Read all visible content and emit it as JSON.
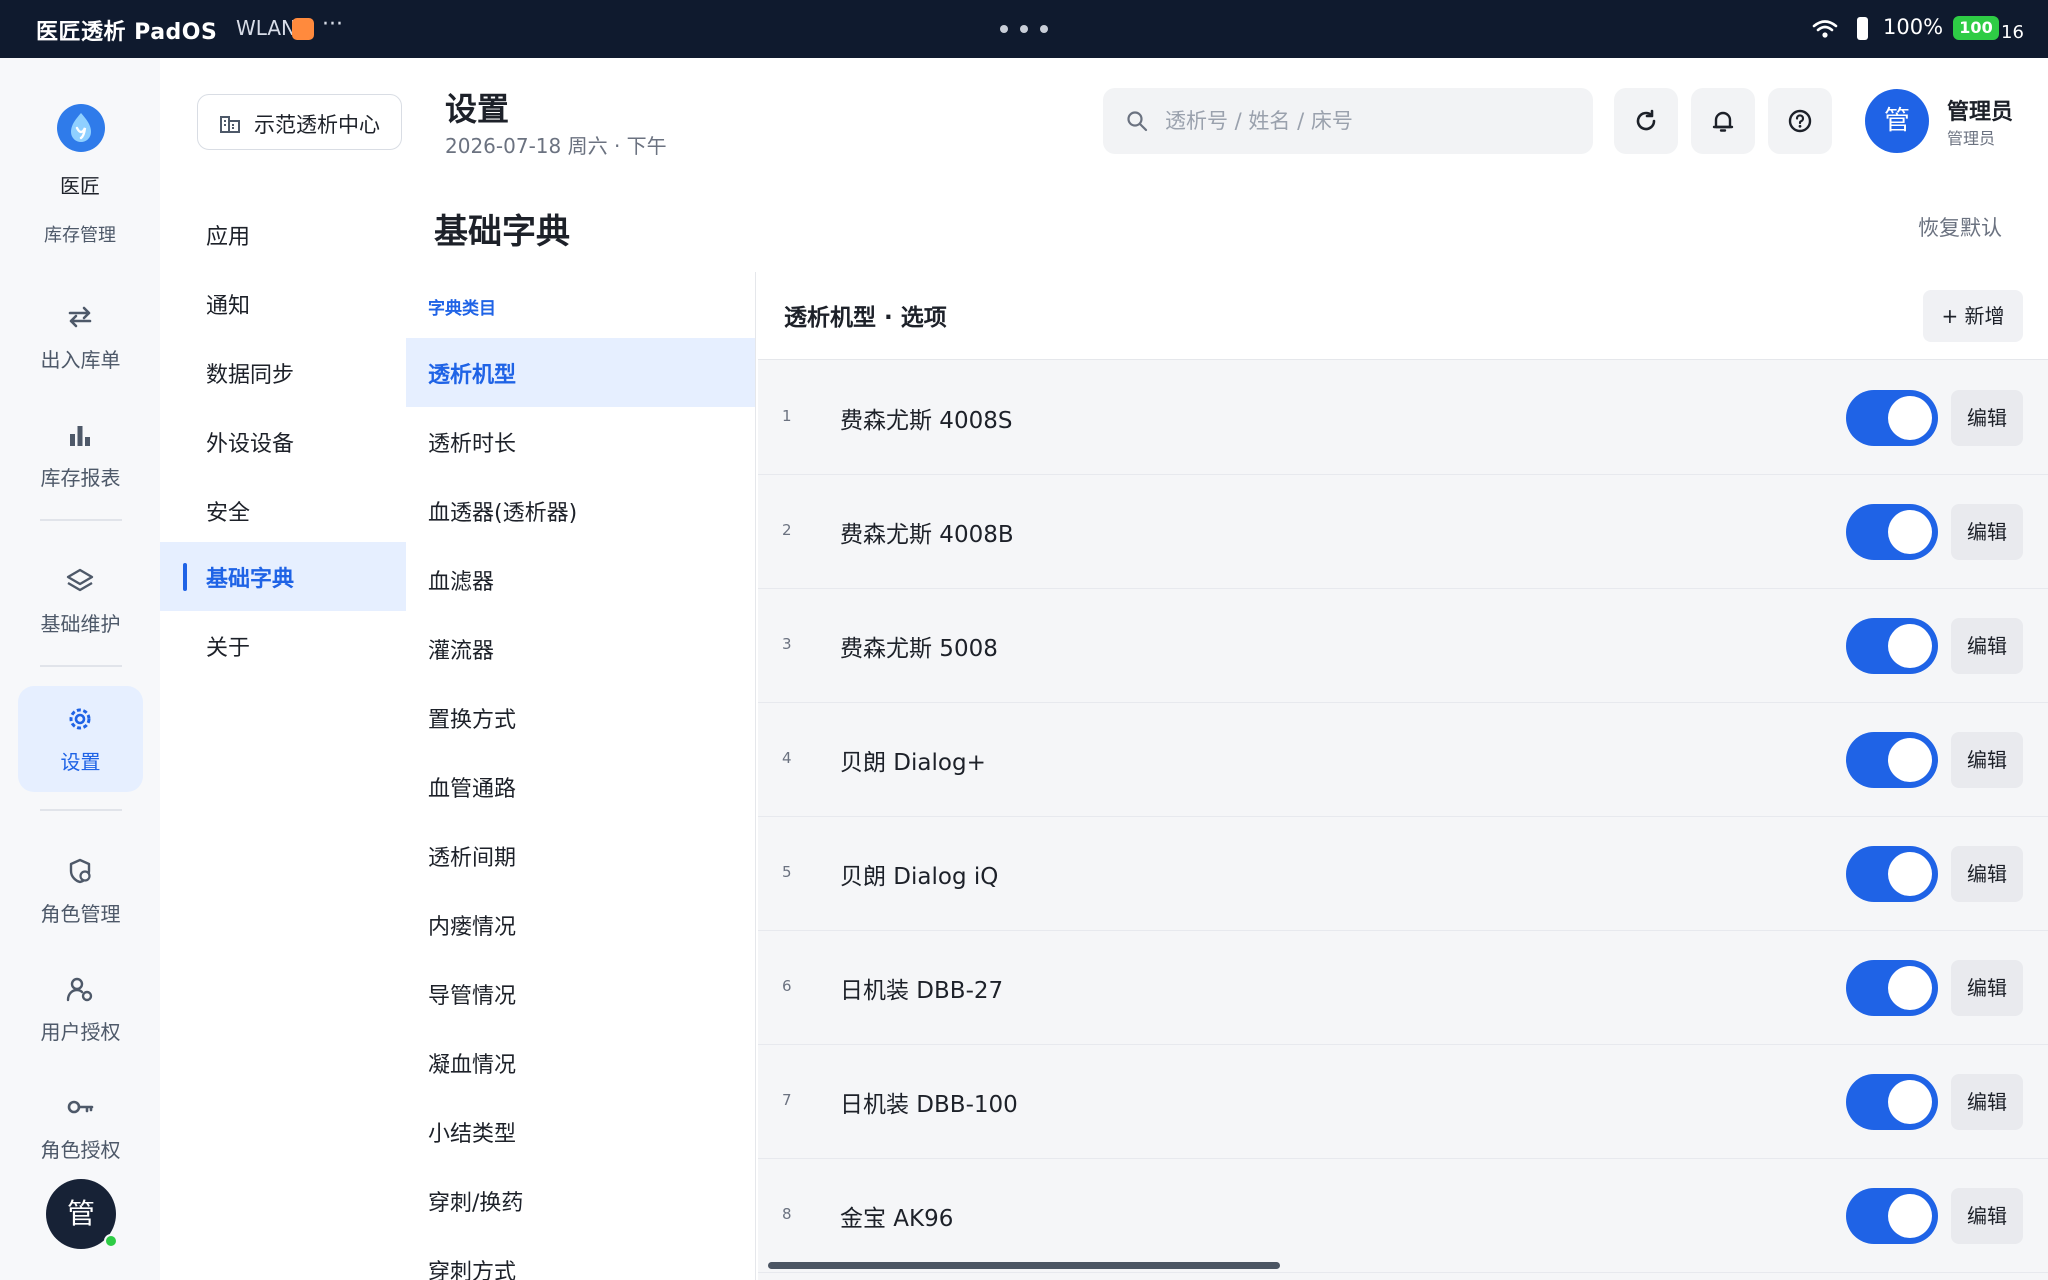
{
  "status_bar": {
    "app_title": "医匠透析 PadOS",
    "network": "WLAN",
    "ellipsis": "···",
    "battery_percent": "100%",
    "battery_badge": "100",
    "battery_tail": "16"
  },
  "rail": {
    "brand_name": "医匠",
    "brand_sub": "库存管理",
    "items": [
      {
        "label": "出入库单",
        "icon": "swap-arrows-icon"
      },
      {
        "label": "库存报表",
        "icon": "bar-chart-icon"
      },
      {
        "label": "基础维护",
        "icon": "layers-icon"
      },
      {
        "label": "设置",
        "icon": "gear-icon"
      },
      {
        "label": "角色管理",
        "icon": "shield-user-icon"
      },
      {
        "label": "用户授权",
        "icon": "user-gear-icon"
      },
      {
        "label": "角色授权",
        "icon": "key-icon"
      }
    ],
    "avatar_text": "管"
  },
  "center_chip": {
    "label": "示范透析中心",
    "icon": "building-icon"
  },
  "header": {
    "title": "设置",
    "date": "2026-07-18 周六 · 下午",
    "search_placeholder": "透析号 / 姓名 / 床号",
    "user_avatar": "管",
    "user_name": "管理员",
    "user_role": "管理员"
  },
  "settings_nav": {
    "items": [
      {
        "label": "应用"
      },
      {
        "label": "通知"
      },
      {
        "label": "数据同步"
      },
      {
        "label": "外设设备"
      },
      {
        "label": "安全"
      },
      {
        "label": "基础字典",
        "active": true
      },
      {
        "label": "关于"
      }
    ]
  },
  "section": {
    "title": "基础字典",
    "reset_label": "恢复默认"
  },
  "categories": {
    "heading": "字典类目",
    "items": [
      {
        "label": "透析机型",
        "active": true
      },
      {
        "label": "透析时长"
      },
      {
        "label": "血透器(透析器)"
      },
      {
        "label": "血滤器"
      },
      {
        "label": "灌流器"
      },
      {
        "label": "置换方式"
      },
      {
        "label": "血管通路"
      },
      {
        "label": "透析间期"
      },
      {
        "label": "内瘘情况"
      },
      {
        "label": "导管情况"
      },
      {
        "label": "凝血情况"
      },
      {
        "label": "小结类型"
      },
      {
        "label": "穿刺/换药"
      },
      {
        "label": "穿刺方式"
      }
    ]
  },
  "options": {
    "title": "透析机型 · 选项",
    "add_label": "+ 新增",
    "edit_label": "编辑",
    "rows": [
      {
        "index": "1",
        "name": "费森尤斯 4008S",
        "enabled": true
      },
      {
        "index": "2",
        "name": "费森尤斯 4008B",
        "enabled": true
      },
      {
        "index": "3",
        "name": "费森尤斯 5008",
        "enabled": true
      },
      {
        "index": "4",
        "name": "贝朗 Dialog+",
        "enabled": true
      },
      {
        "index": "5",
        "name": "贝朗 Dialog iQ",
        "enabled": true
      },
      {
        "index": "6",
        "name": "日机装 DBB-27",
        "enabled": true
      },
      {
        "index": "7",
        "name": "日机装 DBB-100",
        "enabled": true
      },
      {
        "index": "8",
        "name": "金宝 AK96",
        "enabled": true
      }
    ]
  },
  "colors": {
    "accent": "#1f63e6",
    "status_bar_bg": "#0f1a2e",
    "active_bg": "#e6efff",
    "battery_green": "#2ecc45"
  }
}
